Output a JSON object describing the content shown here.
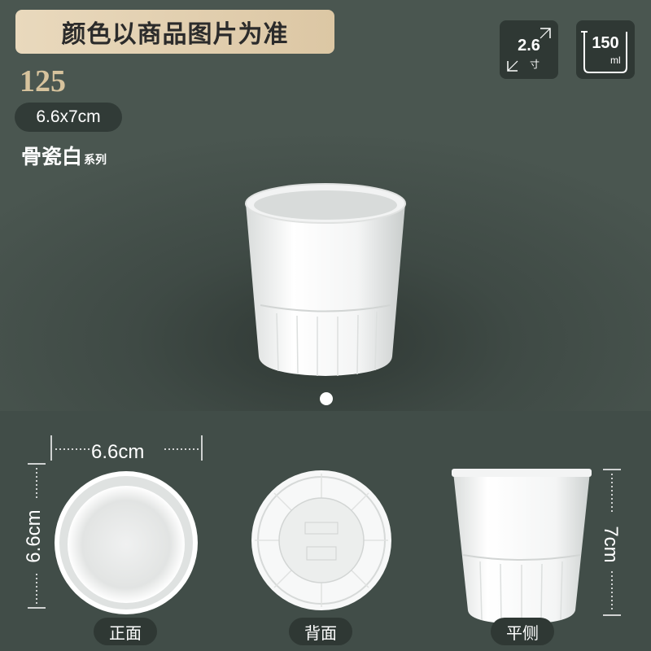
{
  "banner": {
    "text": "颜色以商品图片为准"
  },
  "model": {
    "number": "125"
  },
  "size": {
    "label": "6.6x7cm"
  },
  "series": {
    "name": "骨瓷白",
    "suffix": "系列"
  },
  "specs": {
    "diameter": {
      "value": "2.6",
      "unit": "寸"
    },
    "capacity": {
      "value": "150",
      "unit": "ml"
    }
  },
  "dimensions": {
    "width": "6.6cm",
    "depth": "6.6cm",
    "height": "7cm"
  },
  "views": {
    "front": "正面",
    "back": "背面",
    "side": "平侧"
  },
  "colors": {
    "banner": "#e2cfae",
    "model_text": "#d7c39d",
    "background": "#46524c"
  }
}
